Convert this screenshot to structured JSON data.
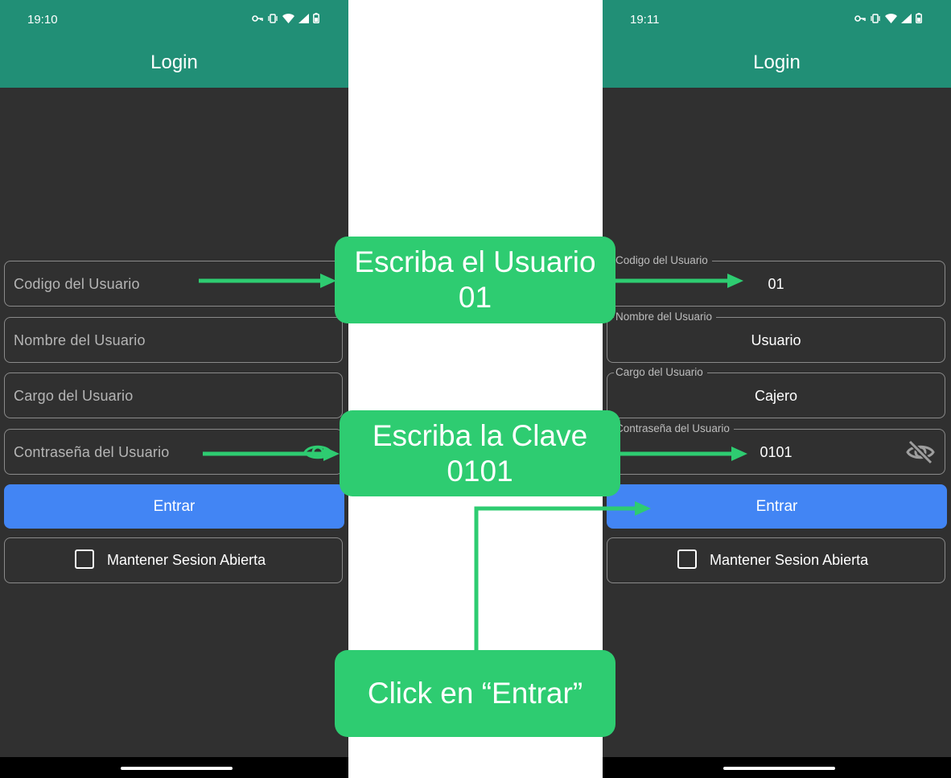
{
  "left_screen": {
    "status_time": "19:10",
    "app_title": "Login",
    "fields": [
      {
        "placeholder": "Codigo del Usuario"
      },
      {
        "placeholder": "Nombre del Usuario"
      },
      {
        "placeholder": "Cargo del Usuario"
      },
      {
        "placeholder": "Contraseña del Usuario"
      }
    ],
    "enter_button": "Entrar",
    "keep_session_label": "Mantener Sesion Abierta",
    "keep_session_checked": false
  },
  "right_screen": {
    "status_time": "19:11",
    "app_title": "Login",
    "fields": [
      {
        "label": "Codigo del Usuario",
        "value": "01"
      },
      {
        "label": "Nombre del Usuario",
        "value": "Usuario"
      },
      {
        "label": "Cargo del Usuario",
        "value": "Cajero"
      },
      {
        "label": "Contraseña del Usuario",
        "value": "0101"
      }
    ],
    "enter_button": "Entrar",
    "keep_session_label": "Mantener Sesion Abierta",
    "keep_session_checked": false
  },
  "callouts": {
    "user": {
      "line1": "Escriba el Usuario",
      "line2": "01"
    },
    "password": {
      "line1": "Escriba la Clave",
      "line2": "0101"
    },
    "click": {
      "line1": "Click en “Entrar”"
    }
  },
  "colors": {
    "app_bar": "#218f76",
    "background": "#303030",
    "primary_button": "#4285f4",
    "callout": "#2ecc71",
    "arrow": "#2ecc71"
  },
  "icons": {
    "left_password_toggle": "eye-icon",
    "right_password_toggle": "eye-off-icon"
  }
}
